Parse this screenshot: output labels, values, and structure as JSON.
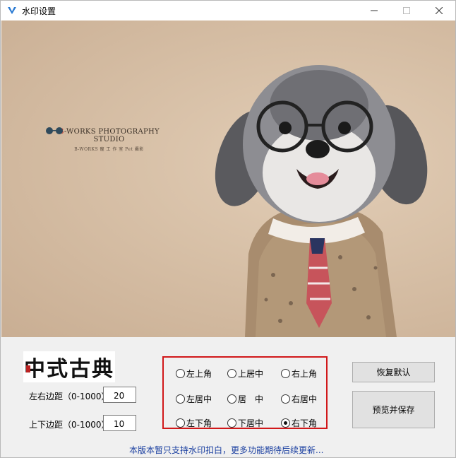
{
  "window": {
    "title": "水印设置"
  },
  "preview": {
    "studio_name_initial": "B",
    "studio_name_rest": "-WORKS PHOTOGRAPHY STUDIO",
    "studio_subtitle": "B-WORKS 寵 工 作 室 Pet 攝影"
  },
  "watermark_logo": {
    "text": "中式古典"
  },
  "margins": {
    "horizontal_label": "左右边距（0-1000）",
    "horizontal_value": "20",
    "vertical_label": "上下边距（0-1000）",
    "vertical_value": "10"
  },
  "positions": [
    {
      "label": "左上角",
      "selected": false
    },
    {
      "label": "上居中",
      "selected": false
    },
    {
      "label": "右上角",
      "selected": false
    },
    {
      "label": "左居中",
      "selected": false
    },
    {
      "label": "居　中",
      "selected": false
    },
    {
      "label": "右居中",
      "selected": false
    },
    {
      "label": "左下角",
      "selected": false
    },
    {
      "label": "下居中",
      "selected": false
    },
    {
      "label": "右下角",
      "selected": true
    }
  ],
  "buttons": {
    "reset_label": "恢复默认",
    "save_label": "预览并保存"
  },
  "footer_note": "本版本暂只支持水印扣白，更多功能期待后续更新...",
  "colors": {
    "highlight_border": "#d1181a",
    "note_text": "#1a3fa0"
  }
}
